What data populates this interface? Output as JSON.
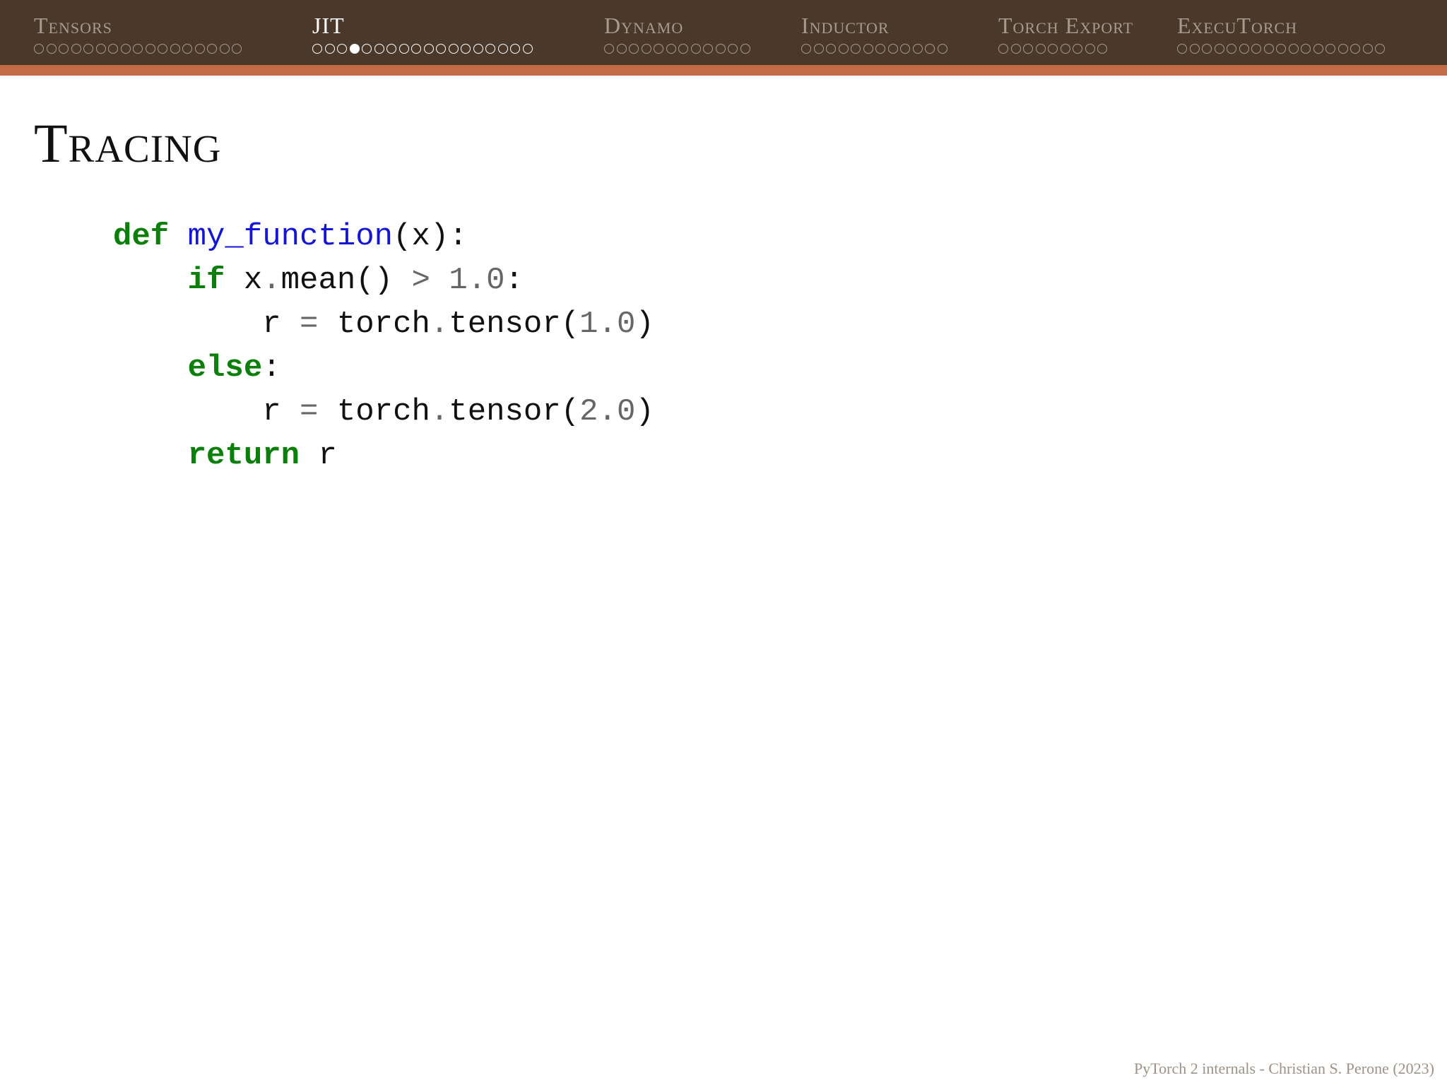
{
  "nav": {
    "sections": [
      {
        "title": "Tensors",
        "dots": 17,
        "current": -1,
        "active": false
      },
      {
        "title": "JIT",
        "dots": 18,
        "current": 3,
        "active": true
      },
      {
        "title": "Dynamo",
        "dots": 12,
        "current": -1,
        "active": false
      },
      {
        "title": "Inductor",
        "dots": 12,
        "current": -1,
        "active": false
      },
      {
        "title": "Torch Export",
        "dots": 9,
        "current": -1,
        "active": false
      },
      {
        "title": "ExecuTorch",
        "dots": 17,
        "current": -1,
        "active": false
      }
    ],
    "colors": {
      "header_bg": "#4a392b",
      "accent_bar": "#c36b45",
      "inactive": "#a59a8e",
      "active": "#ffffff"
    }
  },
  "slide": {
    "title": "Tracing",
    "code_lines": [
      [
        {
          "t": "def",
          "c": "kw"
        },
        {
          "t": " "
        },
        {
          "t": "my_function",
          "c": "fn"
        },
        {
          "t": "(x):"
        }
      ],
      [
        {
          "t": "    "
        },
        {
          "t": "if",
          "c": "kw"
        },
        {
          "t": " x"
        },
        {
          "t": ".",
          "c": "op"
        },
        {
          "t": "mean() "
        },
        {
          "t": ">",
          "c": "op"
        },
        {
          "t": " "
        },
        {
          "t": "1.0",
          "c": "num"
        },
        {
          "t": ":"
        }
      ],
      [
        {
          "t": "        r "
        },
        {
          "t": "=",
          "c": "op"
        },
        {
          "t": " torch"
        },
        {
          "t": ".",
          "c": "op"
        },
        {
          "t": "tensor("
        },
        {
          "t": "1.0",
          "c": "num"
        },
        {
          "t": ")"
        }
      ],
      [
        {
          "t": "    "
        },
        {
          "t": "else",
          "c": "kw"
        },
        {
          "t": ":"
        }
      ],
      [
        {
          "t": "        r "
        },
        {
          "t": "=",
          "c": "op"
        },
        {
          "t": " torch"
        },
        {
          "t": ".",
          "c": "op"
        },
        {
          "t": "tensor("
        },
        {
          "t": "2.0",
          "c": "num"
        },
        {
          "t": ")"
        }
      ],
      [
        {
          "t": "    "
        },
        {
          "t": "return",
          "c": "kw"
        },
        {
          "t": " r"
        }
      ]
    ],
    "syntax_colors": {
      "keyword": "#0a7f0a",
      "function": "#1515d6",
      "number": "#666666"
    }
  },
  "footer": {
    "text": "PyTorch 2 internals - Christian S. Perone (2023)"
  }
}
